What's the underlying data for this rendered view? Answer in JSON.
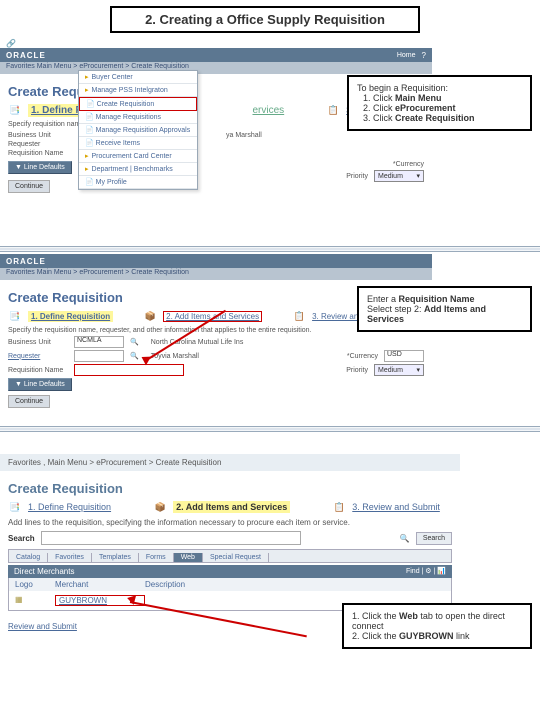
{
  "page_title": "2. Creating a Office Supply Requisition",
  "oracle_brand": "ORACLE",
  "breadcrumb1": "Favorites   Main Menu  >  eProcurement  >  Create Requisition",
  "breadcrumb3": "Favorites  ,  Main Menu  >  eProcurement  >  Create Requisition",
  "create_req": "Create Requisition",
  "step1": "1. Define Requisition",
  "step1_short": "1. Define Re",
  "step2": "2. Add Items and Services",
  "step3_short": "3. Review and Submit",
  "step3_full": "3. Review and Submit",
  "home": "Home",
  "help_tiny": "?",
  "spec_text": "Specify requisition name",
  "spec_text2": "Specify the requisition name, requester, and other information that applies to the entire requisition.",
  "spec_text3": "Add lines to the requisition, specifying the information necessary to procure each item or service.",
  "labels": {
    "bu": "Business Unit",
    "requester": "Requester",
    "req_name": "Requisition Name",
    "priority": "Priority",
    "currency": "*Currency",
    "search": "Search"
  },
  "field_vals": {
    "requester_name": "Toyvia Marshall",
    "bu_val": "NCMLA",
    "currency_val": "USD",
    "priority_val": "Medium"
  },
  "btn_line_defaults": "▼ Line Defaults",
  "btn_continue": "Continue",
  "menu_items": [
    "Buyer Center",
    "Manage PSS Intelgraton",
    "Create Requisition",
    "Manage Requisitions",
    "Manage Requisition Approvals",
    "Receive Items",
    "Procurement Card Center",
    "Department  |  Benchmarks",
    "My Profile"
  ],
  "direct_merchants": "Direct Merchants",
  "table_hdrs": {
    "logo": "Logo",
    "merchant": "Merchant",
    "desc": "Description"
  },
  "merchant_row": "GUYBROWN",
  "tabs": [
    "Catalog",
    "Favorites",
    "Templates",
    "Forms",
    "Web",
    "Special Request"
  ],
  "callout1": {
    "lead": "To begin a Requisition:",
    "l1": "Click ",
    "l1b": "Main Menu",
    "l2": "Click ",
    "l2b": "eProcurement",
    "l3": "Click ",
    "l3b": "Create Requisition"
  },
  "callout2": {
    "p1": "Enter a ",
    "p1b": "Requisition Name",
    "p2a": "Select step 2: ",
    "p2b": "Add Items and Services"
  },
  "callout3": {
    "l1a": "1. Click the ",
    "l1b": "Web",
    "l1c": " tab to open the direct connect",
    "l2a": "2. Click the ",
    "l2b": "GUYBROWN",
    "l2c": " link"
  },
  "review_submit": "Review and Submit",
  "search_btn": "Search",
  "menu_icons": [
    "📄",
    "📄",
    "📄",
    "📄",
    "📄",
    "📄",
    "📁",
    "📁",
    "📄"
  ]
}
